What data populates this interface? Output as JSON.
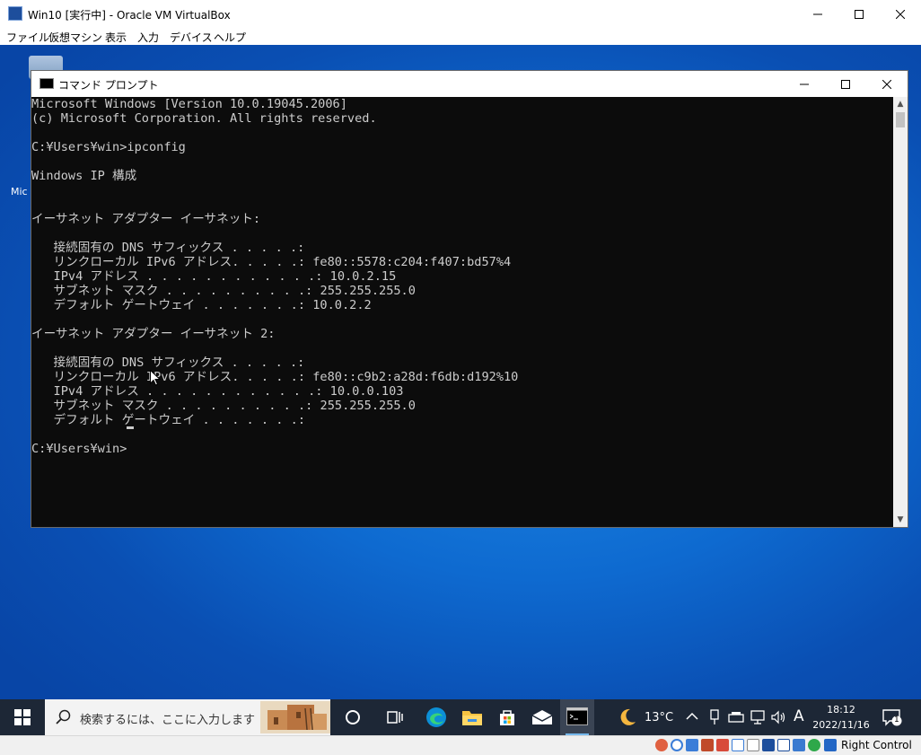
{
  "vbox": {
    "title": "Win10 [実行中] - Oracle VM VirtualBox",
    "menu": [
      "ファイル",
      "仮想マシン",
      "表示",
      "入力",
      "デバイス",
      "ヘルプ"
    ],
    "host_key": "Right Control"
  },
  "desktop": {
    "icon_label_partial": "Mic"
  },
  "cmd": {
    "title": "コマンド プロンプト",
    "lines": [
      "Microsoft Windows [Version 10.0.19045.2006]",
      "(c) Microsoft Corporation. All rights reserved.",
      "",
      "C:¥Users¥win>ipconfig",
      "",
      "Windows IP 構成",
      "",
      "",
      "イーサネット アダプター イーサネット:",
      "",
      "   接続固有の DNS サフィックス . . . . .:",
      "   リンクローカル IPv6 アドレス. . . . .: fe80::5578:c204:f407:bd57%4",
      "   IPv4 アドレス . . . . . . . . . . . .: 10.0.2.15",
      "   サブネット マスク . . . . . . . . . .: 255.255.255.0",
      "   デフォルト ゲートウェイ . . . . . . .: 10.0.2.2",
      "",
      "イーサネット アダプター イーサネット 2:",
      "",
      "   接続固有の DNS サフィックス . . . . .:",
      "   リンクローカル IPv6 アドレス. . . . .: fe80::c9b2:a28d:f6db:d192%10",
      "   IPv4 アドレス . . . . . . . . . . . .: 10.0.0.103",
      "   サブネット マスク . . . . . . . . . .: 255.255.255.0",
      "   デフォルト ゲートウェイ . . . . . . .:",
      "",
      "C:¥Users¥win>"
    ]
  },
  "taskbar": {
    "search_placeholder": "検索するには、ここに入力します",
    "pinned": [
      "task-view-icon",
      "edge-icon",
      "file-explorer-icon",
      "store-icon",
      "mail-icon",
      "cmd-icon"
    ],
    "weather_temp": "13°C",
    "ime_mode": "A",
    "time": "18:12",
    "date": "2022/11/16",
    "notification_count": "1"
  },
  "colors": {
    "console_bg": "#0c0c0c",
    "console_fg": "#cccccc",
    "taskbar_bg": "#1d2736",
    "desktop_blue": "#0e6ad0"
  }
}
